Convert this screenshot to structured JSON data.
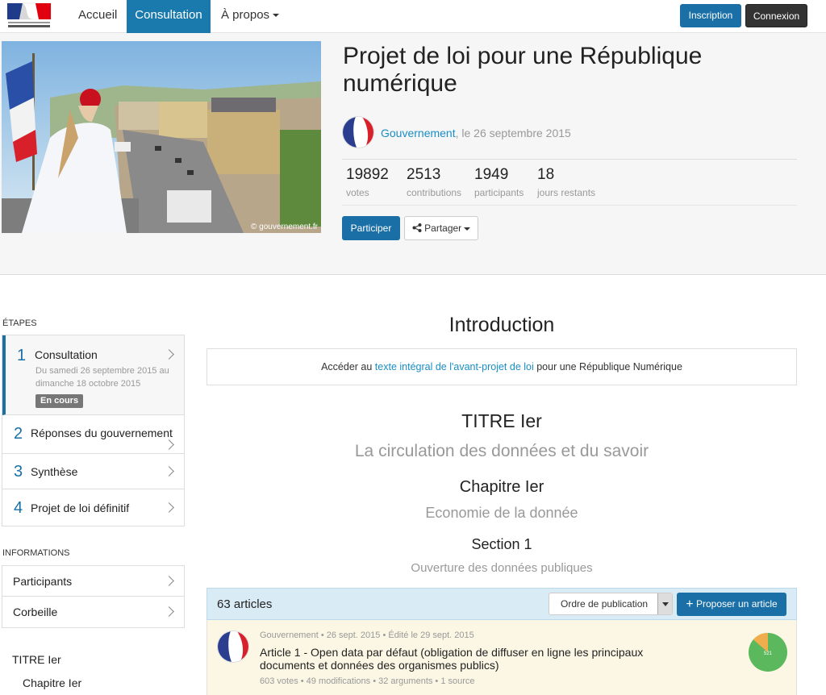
{
  "nav": {
    "items": [
      "Accueil",
      "Consultation",
      "À propos"
    ],
    "inscription": "Inscription",
    "connexion": "Connexion"
  },
  "hero": {
    "title": "Projet de loi pour une République numérique",
    "image_credit": "© gouvernement.fr",
    "author": "Gouvernement",
    "date": ", le 26 septembre 2015",
    "stats": [
      {
        "value": "19892",
        "label": "votes"
      },
      {
        "value": "2513",
        "label": "contributions"
      },
      {
        "value": "1949",
        "label": "participants"
      },
      {
        "value": "18",
        "label": "jours restants"
      }
    ],
    "participer": "Participer",
    "partager": "Partager"
  },
  "sidebar": {
    "steps_heading": "ÉTAPES",
    "steps": [
      {
        "num": "1",
        "title": "Consultation",
        "sub": "Du samedi 26 septembre 2015 au dimanche 18 octobre 2015",
        "badge": "En cours"
      },
      {
        "num": "2",
        "title": "Réponses du gouvernement"
      },
      {
        "num": "3",
        "title": "Synthèse"
      },
      {
        "num": "4",
        "title": "Projet de loi définitif"
      }
    ],
    "info_heading": "INFORMATIONS",
    "info_items": [
      "Participants",
      "Corbeille"
    ],
    "toc": [
      "TITRE Ier",
      "Chapitre Ier"
    ]
  },
  "main": {
    "intro_heading": "Introduction",
    "intro_prefix": "Accéder au ",
    "intro_link": "texte intégral de l'avant-projet de loi",
    "intro_suffix": " pour une République Numérique",
    "titre": "TITRE Ier",
    "titre_sub": "La circulation des données et du savoir",
    "chapitre": "Chapitre Ier",
    "chapitre_sub": "Economie de la donnée",
    "section": "Section 1",
    "section_sub": "Ouverture des données publiques",
    "articles_count": "63 articles",
    "order_label": "Ordre de publication",
    "propose_label": "Proposer un article",
    "article": {
      "meta": "Gouvernement • 26 sept. 2015 • Édité le 29 sept. 2015",
      "title": "Article 1 - Open data par défaut (obligation de diffuser en ligne les principaux documents et données des organismes publics)",
      "stats": "603 votes • 49 modifications • 32 arguments • 1 source",
      "pie_label": "521",
      "pie_share": 0.864
    }
  },
  "colors": {
    "primary": "#1a6fa7",
    "link": "#1a8ec4",
    "pie_green": "#5cb85c",
    "pie_orange": "#f0ad4e"
  }
}
